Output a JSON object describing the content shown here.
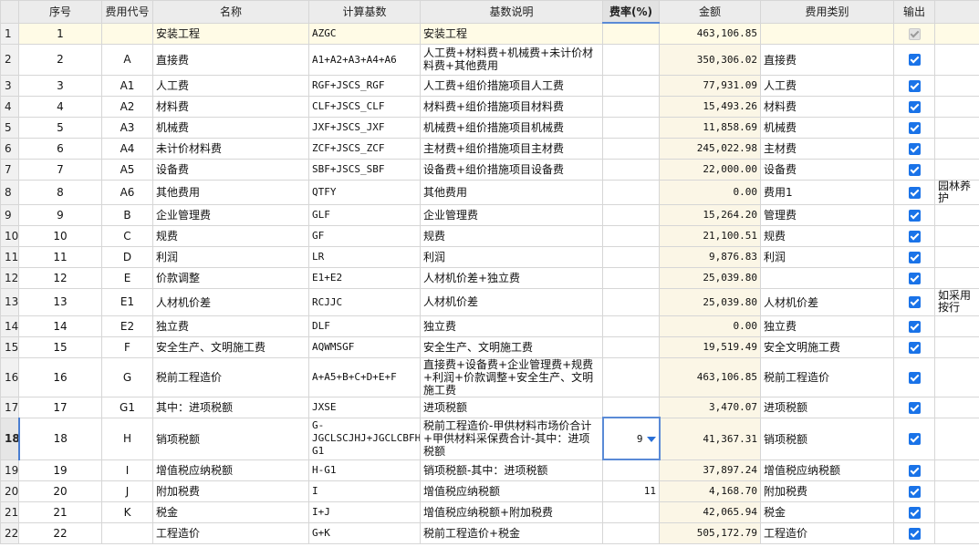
{
  "headers": [
    "",
    "序号",
    "费用代号",
    "名称",
    "计算基数",
    "基数说明",
    "费率(%)",
    "金额",
    "费用类别",
    "输出",
    ""
  ],
  "rows": [
    {
      "rn": "1",
      "seq": "1",
      "code": "",
      "name": "安装工程",
      "base": "AZGC",
      "desc": "安装工程",
      "rate": "",
      "amount": "463,106.85",
      "cat": "",
      "output": "disabled",
      "note": ""
    },
    {
      "rn": "2",
      "seq": "2",
      "code": "A",
      "name": "直接费",
      "base": "A1+A2+A3+A4+A6",
      "desc": "人工费+材料费+机械费+未计价材料费+其他费用",
      "rate": "",
      "amount": "350,306.02",
      "cat": "直接费",
      "output": "checked",
      "note": ""
    },
    {
      "rn": "3",
      "seq": "3",
      "code": "A1",
      "name": "人工费",
      "base": "RGF+JSCS_RGF",
      "desc": "人工费+组价措施项目人工费",
      "rate": "",
      "amount": "77,931.09",
      "cat": "人工费",
      "output": "checked",
      "note": ""
    },
    {
      "rn": "4",
      "seq": "4",
      "code": "A2",
      "name": "材料费",
      "base": "CLF+JSCS_CLF",
      "desc": "材料费+组价措施项目材料费",
      "rate": "",
      "amount": "15,493.26",
      "cat": "材料费",
      "output": "checked",
      "note": ""
    },
    {
      "rn": "5",
      "seq": "5",
      "code": "A3",
      "name": "机械费",
      "base": "JXF+JSCS_JXF",
      "desc": "机械费+组价措施项目机械费",
      "rate": "",
      "amount": "11,858.69",
      "cat": "机械费",
      "output": "checked",
      "note": ""
    },
    {
      "rn": "6",
      "seq": "6",
      "code": "A4",
      "name": "未计价材料费",
      "base": "ZCF+JSCS_ZCF",
      "desc": "主材费+组价措施项目主材费",
      "rate": "",
      "amount": "245,022.98",
      "cat": "主材费",
      "output": "checked",
      "note": ""
    },
    {
      "rn": "7",
      "seq": "7",
      "code": "A5",
      "name": "设备费",
      "base": "SBF+JSCS_SBF",
      "desc": "设备费+组价措施项目设备费",
      "rate": "",
      "amount": "22,000.00",
      "cat": "设备费",
      "output": "checked",
      "note": ""
    },
    {
      "rn": "8",
      "seq": "8",
      "code": "A6",
      "name": "其他费用",
      "base": "QTFY",
      "desc": "其他费用",
      "rate": "",
      "amount": "0.00",
      "cat": "费用1",
      "output": "checked",
      "note": "园林养护"
    },
    {
      "rn": "9",
      "seq": "9",
      "code": "B",
      "name": "企业管理费",
      "base": "GLF",
      "desc": "企业管理费",
      "rate": "",
      "amount": "15,264.20",
      "cat": "管理费",
      "output": "checked",
      "note": ""
    },
    {
      "rn": "10",
      "seq": "10",
      "code": "C",
      "name": "规费",
      "base": "GF",
      "desc": "规费",
      "rate": "",
      "amount": "21,100.51",
      "cat": "规费",
      "output": "checked",
      "note": ""
    },
    {
      "rn": "11",
      "seq": "11",
      "code": "D",
      "name": "利润",
      "base": "LR",
      "desc": "利润",
      "rate": "",
      "amount": "9,876.83",
      "cat": "利润",
      "output": "checked",
      "note": ""
    },
    {
      "rn": "12",
      "seq": "12",
      "code": "E",
      "name": "价款调整",
      "base": "E1+E2",
      "desc": "人材机价差+独立费",
      "rate": "",
      "amount": "25,039.80",
      "cat": "",
      "output": "checked",
      "note": ""
    },
    {
      "rn": "13",
      "seq": "13",
      "code": "E1",
      "name": "人材机价差",
      "base": "RCJJC",
      "desc": "人材机价差",
      "rate": "",
      "amount": "25,039.80",
      "cat": "人材机价差",
      "output": "checked",
      "note": "如采用按行"
    },
    {
      "rn": "14",
      "seq": "14",
      "code": "E2",
      "name": "独立费",
      "base": "DLF",
      "desc": "独立费",
      "rate": "",
      "amount": "0.00",
      "cat": "独立费",
      "output": "checked",
      "note": ""
    },
    {
      "rn": "15",
      "seq": "15",
      "code": "F",
      "name": "安全生产、文明施工费",
      "base": "AQWMSGF",
      "desc": "安全生产、文明施工费",
      "rate": "",
      "amount": "19,519.49",
      "cat": "安全文明施工费",
      "output": "checked",
      "note": ""
    },
    {
      "rn": "16",
      "seq": "16",
      "code": "G",
      "name": "税前工程造价",
      "base": "A+A5+B+C+D+E+F",
      "desc": "直接费+设备费+企业管理费+规费+利润+价款调整+安全生产、文明施工费",
      "rate": "",
      "amount": "463,106.85",
      "cat": "税前工程造价",
      "output": "checked",
      "note": ""
    },
    {
      "rn": "17",
      "seq": "17",
      "code": "G1",
      "name": "其中：进项税额",
      "base": "JXSE",
      "desc": "进项税额",
      "rate": "",
      "amount": "3,470.07",
      "cat": "进项税额",
      "output": "checked",
      "note": ""
    },
    {
      "rn": "18",
      "seq": "18",
      "code": "H",
      "name": "销项税额",
      "base": "G-JGCLSCJHJ+JGCLCBFHJ-G1",
      "desc": "税前工程造价-甲供材料市场价合计+甲供材料采保费合计-其中：进项税额",
      "rate": "9",
      "amount": "41,367.31",
      "cat": "销项税额",
      "output": "checked",
      "note": ""
    },
    {
      "rn": "19",
      "seq": "19",
      "code": "I",
      "name": "增值税应纳税额",
      "base": "H-G1",
      "desc": "销项税额-其中：进项税额",
      "rate": "",
      "amount": "37,897.24",
      "cat": "增值税应纳税额",
      "output": "checked",
      "note": ""
    },
    {
      "rn": "20",
      "seq": "20",
      "code": "J",
      "name": "附加税费",
      "base": "I",
      "desc": "增值税应纳税额",
      "rate": "11",
      "amount": "4,168.70",
      "cat": "附加税费",
      "output": "checked",
      "note": ""
    },
    {
      "rn": "21",
      "seq": "21",
      "code": "K",
      "name": "税金",
      "base": "I+J",
      "desc": "增值税应纳税额+附加税费",
      "rate": "",
      "amount": "42,065.94",
      "cat": "税金",
      "output": "checked",
      "note": ""
    },
    {
      "rn": "22",
      "seq": "22",
      "code": "",
      "name": "工程造价",
      "base": "G+K",
      "desc": "税前工程造价+税金",
      "rate": "",
      "amount": "505,172.79",
      "cat": "工程造价",
      "output": "checked",
      "note": ""
    }
  ]
}
